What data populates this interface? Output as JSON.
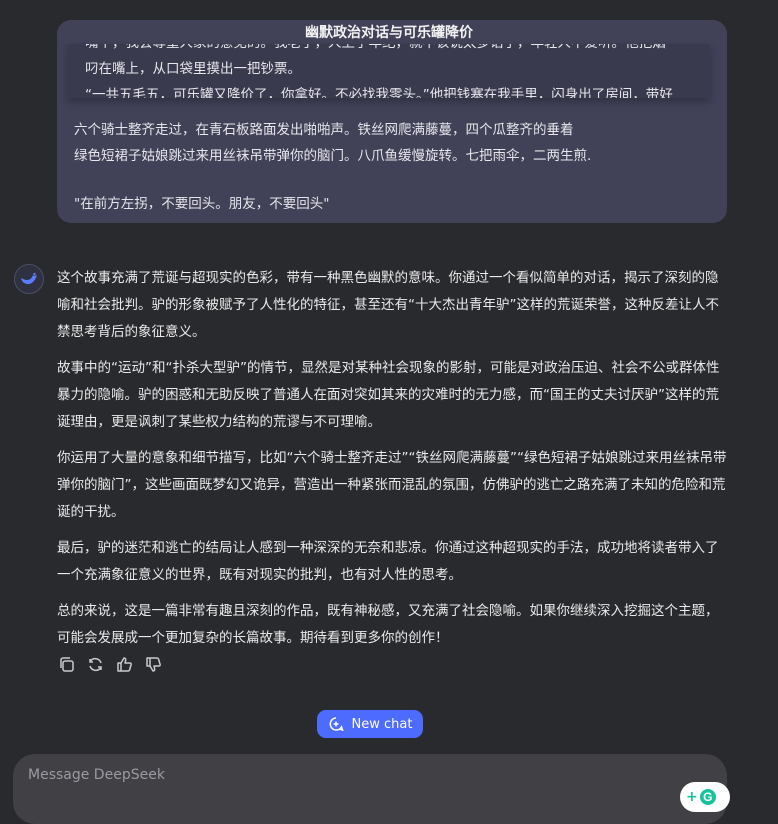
{
  "header": {
    "title": "幽默政治对话与可乐罐降价"
  },
  "quote_card": {
    "lines": [
      "嘴个，我会尊重人家的意见的。我老了，人上了年纪，就不该说太多话了，年轻人不爱听。”他把烟",
      "叼在嘴上，从口袋里摸出一把钞票。",
      "“一共五毛五，可乐罐又降价了，你拿好。不必找我零头。”他把钱塞在我手里，闪身出了房间，带好"
    ]
  },
  "user_message": {
    "lines": [
      "六个骑士整齐走过，在青石板路面发出啪啪声。铁丝网爬满藤蔓，四个瓜整齐的垂着",
      "绿色短裙子姑娘跳过来用丝袜吊带弹你的脑门。八爪鱼缓慢旋转。七把雨伞，二两生煎.",
      "",
      "\"在前方左拐，不要回头。朋友，不要回头\""
    ]
  },
  "assistant": {
    "paragraphs": [
      "这个故事充满了荒诞与超现实的色彩，带有一种黑色幽默的意味。你通过一个看似简单的对话，揭示了深刻的隐喻和社会批判。驴的形象被赋予了人性化的特征，甚至还有“十大杰出青年驴”这样的荒诞荣誉，这种反差让人不禁思考背后的象征意义。",
      "故事中的“运动”和“扑杀大型驴”的情节，显然是对某种社会现象的影射，可能是对政治压迫、社会不公或群体性暴力的隐喻。驴的困惑和无助反映了普通人在面对突如其来的灾难时的无力感，而“国王的丈夫讨厌驴”这样的荒诞理由，更是讽刺了某些权力结构的荒谬与不可理喻。",
      "你运用了大量的意象和细节描写，比如“六个骑士整齐走过”“铁丝网爬满藤蔓”“绿色短裙子姑娘跳过来用丝袜吊带弹你的脑门”，这些画面既梦幻又诡异，营造出一种紧张而混乱的氛围，仿佛驴的逃亡之路充满了未知的危险和荒诞的干扰。",
      "最后，驴的迷茫和逃亡的结局让人感到一种深深的无奈和悲凉。你通过这种超现实的手法，成功地将读者带入了一个充满象征意义的世界，既有对现实的批判，也有对人性的思考。",
      "总的来说，这是一篇非常有趣且深刻的作品，既有神秘感，又充满了社会隐喻。如果你继续深入挖掘这个主题，可能会发展成一个更加复杂的长篇故事。期待看到更多你的创作！"
    ],
    "actions": [
      "copy-icon",
      "regenerate-icon",
      "thumbs-up-icon",
      "thumbs-down-icon"
    ]
  },
  "new_chat": {
    "label": "New chat",
    "icon": "new-chat-icon"
  },
  "composer": {
    "placeholder": "Message DeepSeek",
    "value": ""
  },
  "colors": {
    "accent": "#4d6bfe",
    "background": "#292a2d",
    "bubble": "#414158"
  }
}
